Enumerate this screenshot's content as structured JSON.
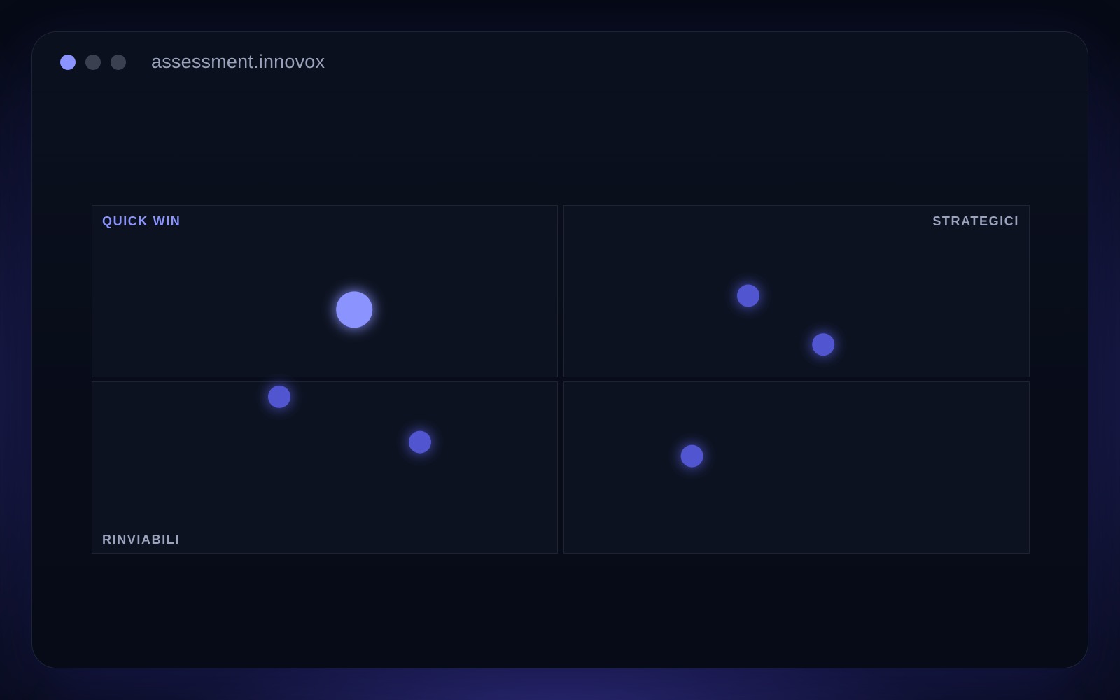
{
  "window": {
    "title": "assessment.innovox",
    "controls": [
      {
        "name": "window-control-1",
        "color": "#8b93ff"
      },
      {
        "name": "window-control-2",
        "color": "#3a4050"
      },
      {
        "name": "window-control-3",
        "color": "#3a4050"
      }
    ]
  },
  "colors": {
    "accent": "#8b93ff",
    "bubble": "#5156d0",
    "label_primary": "#8b93ff",
    "label_muted": "#9ba3bf"
  },
  "matrix": {
    "quadrants": {
      "top_left": "QUICK WIN",
      "top_right": "STRATEGICI",
      "bottom_left": "RINVIABILI",
      "bottom_right": ""
    }
  },
  "chart_data": {
    "type": "scatter",
    "title": "",
    "xlabel": "",
    "ylabel": "",
    "xlim": [
      0,
      1
    ],
    "ylim": [
      0,
      1
    ],
    "grid": false,
    "points": [
      {
        "x": 0.28,
        "y": 0.7,
        "size": 26,
        "highlight": true
      },
      {
        "x": 0.2,
        "y": 0.45,
        "size": 16,
        "highlight": false
      },
      {
        "x": 0.35,
        "y": 0.32,
        "size": 16,
        "highlight": false
      },
      {
        "x": 0.7,
        "y": 0.74,
        "size": 16,
        "highlight": false
      },
      {
        "x": 0.78,
        "y": 0.6,
        "size": 16,
        "highlight": false
      },
      {
        "x": 0.64,
        "y": 0.28,
        "size": 16,
        "highlight": false
      }
    ]
  }
}
